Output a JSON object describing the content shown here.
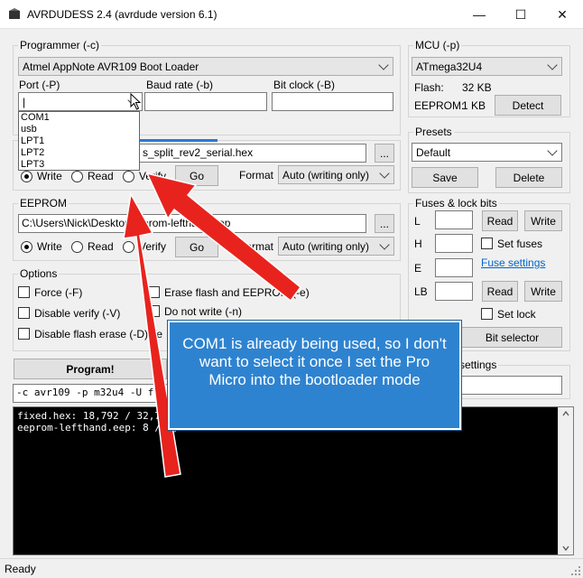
{
  "window": {
    "title": "AVRDUDESS 2.4 (avrdude version 6.1)",
    "minimize": "—",
    "maximize": "☐",
    "close": "✕"
  },
  "programmer": {
    "group_label": "Programmer (-c)",
    "selected": "Atmel AppNote AVR109 Boot Loader",
    "port_label": "Port (-P)",
    "port_value": "|",
    "baud_label": "Baud rate (-b)",
    "bitclock_label": "Bit clock (-B)",
    "port_options": [
      "COM1",
      "usb",
      "LPT1",
      "LPT2",
      "LPT3"
    ]
  },
  "flash": {
    "file": "s_split_rev2_serial.hex",
    "browse": "...",
    "write": "Write",
    "read": "Read",
    "verify": "Verify",
    "go": "Go",
    "format_label": "Format",
    "format_value": "Auto (writing only)"
  },
  "eeprom": {
    "group_label": "EEPROM",
    "file": "C:\\Users\\Nick\\Desktop\\     eprom-lefthand.eep",
    "browse": "...",
    "write": "Write",
    "read": "Read",
    "verify": "Verify",
    "go": "Go",
    "format_label": "Format",
    "format_value": "Auto (writing only)"
  },
  "options": {
    "group_label": "Options",
    "force": "Force (-F)",
    "erase": "Erase flash and EEPROM (-e)",
    "disable_verify": "Disable verify (-V)",
    "no_write": "Do not write (-n)",
    "disable_flash_erase": "Disable flash erase (-D)",
    "verbose_partial": "Ve"
  },
  "mcu": {
    "group_label": "MCU (-p)",
    "selected": "ATmega32U4",
    "flash_label": "Flash:",
    "flash_value": "32 KB",
    "eeprom_label": "EEPROM:",
    "eeprom_value": "1 KB",
    "detect": "Detect"
  },
  "presets": {
    "group_label": "Presets",
    "selected": "Default",
    "save": "Save",
    "delete": "Delete"
  },
  "fuses": {
    "group_label": "Fuses & lock bits",
    "l": "L",
    "h": "H",
    "e": "E",
    "lb": "LB",
    "read": "Read",
    "write": "Write",
    "set_fuses": "Set fuses",
    "fuse_settings": "Fuse settings",
    "set_lock": "Set lock",
    "bit_selector": "Bit selector"
  },
  "program_button": "Program!",
  "settings_partial": "settings",
  "command_line": "-c avr109 -p m32u4 -U flash:",
  "console": {
    "lines": [
      "fixed.hex: 18,792 / 32,768 B",
      "eeprom-lefthand.eep: 8 / 1,0"
    ]
  },
  "status": "Ready",
  "callout": {
    "text": "COM1 is already being used, so I don't want to select it once I set the Pro Micro into the bootloader mode"
  },
  "colors": {
    "arrow": "#e8231e",
    "callout_bg": "#2e83d0",
    "link": "#0066cc"
  }
}
